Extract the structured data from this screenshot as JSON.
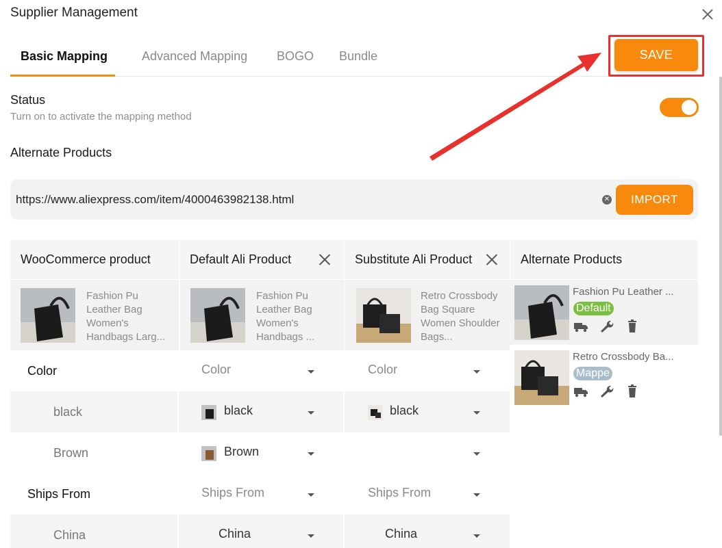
{
  "modal": {
    "title": "Supplier Management"
  },
  "tabs": [
    {
      "label": "Basic Mapping",
      "active": true
    },
    {
      "label": "Advanced Mapping",
      "active": false
    },
    {
      "label": "BOGO",
      "active": false
    },
    {
      "label": "Bundle",
      "active": false
    }
  ],
  "save_label": "SAVE",
  "status": {
    "label": "Status",
    "description": "Turn on to activate the mapping method",
    "enabled": true
  },
  "alternate": {
    "label": "Alternate Products"
  },
  "url_bar": {
    "value": "https://www.aliexpress.com/item/4000463982138.html",
    "import_label": "IMPORT"
  },
  "table": {
    "headers": {
      "woo": "WooCommerce product",
      "default": "Default Ali Product",
      "substitute": "Substitute Ali Product",
      "alternate": "Alternate Products"
    },
    "products": {
      "woo": "Fashion Pu Leather Bag Women's Handbags Larg...",
      "default": "Fashion Pu Leather Bag Women's Handbags ...",
      "substitute": "Retro Crossbody Bag Square Women Shoulder Bags..."
    },
    "rows": [
      {
        "label": "Color",
        "default": "Color",
        "substitute": "Color"
      },
      {
        "label": "black",
        "default": "black",
        "substitute": "black"
      },
      {
        "label": "Brown",
        "default": "Brown",
        "substitute": ""
      },
      {
        "label": "Ships From",
        "default": "Ships From",
        "substitute": "Ships From"
      },
      {
        "label": "China",
        "default": "China",
        "substitute": "China"
      }
    ]
  },
  "alternate_list": [
    {
      "name": "Fashion Pu Leather ...",
      "badge": "Default"
    },
    {
      "name": "Retro Crossbody Ba...",
      "badge": "Mappe"
    }
  ],
  "colors": {
    "accent": "#f7890c",
    "highlight": "#e8312d",
    "badge_default": "#7bbf3e",
    "badge_mapped": "#a9bccb"
  }
}
